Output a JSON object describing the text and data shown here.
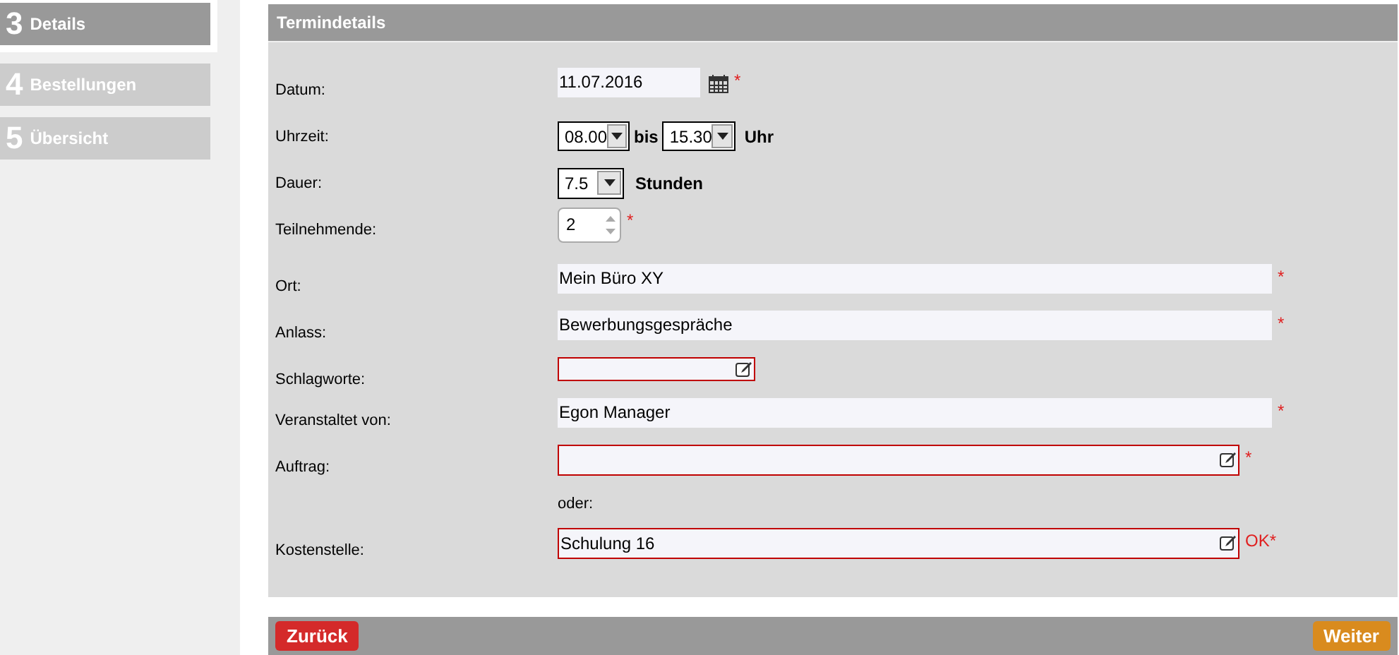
{
  "steps": [
    {
      "number": "3",
      "label": "Details",
      "selected": true
    },
    {
      "number": "4",
      "label": "Bestellungen",
      "selected": false
    },
    {
      "number": "5",
      "label": "Übersicht",
      "selected": false
    }
  ],
  "panel": {
    "title": "Termindetails",
    "rows": [
      {
        "kind": "date",
        "label": "Datum:",
        "value": "11.07.2016",
        "marker": "*"
      },
      {
        "kind": "timerange",
        "label": "Uhrzeit:",
        "from": "08.00",
        "joiner": "bis",
        "to": "15.30",
        "unit": "Uhr"
      },
      {
        "kind": "select",
        "label": "Dauer:",
        "value": "7.5",
        "unit": "Stunden"
      },
      {
        "kind": "spinner",
        "label": "Teilnehmende:",
        "value": "2",
        "marker": "*"
      },
      {
        "kind": "text",
        "label": "Ort:",
        "value": "Mein Büro XY",
        "marker": "*"
      },
      {
        "kind": "text",
        "label": "Anlass:",
        "value": "Bewerbungsgespräche",
        "marker": "*"
      },
      {
        "kind": "tags",
        "label": "Schlagworte:",
        "invalid": true
      },
      {
        "kind": "text",
        "label": "Veranstaltet von:",
        "value": "Egon Manager",
        "marker": "*"
      },
      {
        "kind": "lookup",
        "label": "Auftrag:",
        "invalid": true,
        "marker": "*"
      },
      {
        "kind": "note",
        "text": "oder:"
      },
      {
        "kind": "lookup",
        "label": "Kostenstelle:",
        "value": "Schulung 16",
        "invalid": true,
        "marker": "OK*"
      }
    ]
  },
  "footer": {
    "back": "Zurück",
    "next": "Weiter"
  }
}
